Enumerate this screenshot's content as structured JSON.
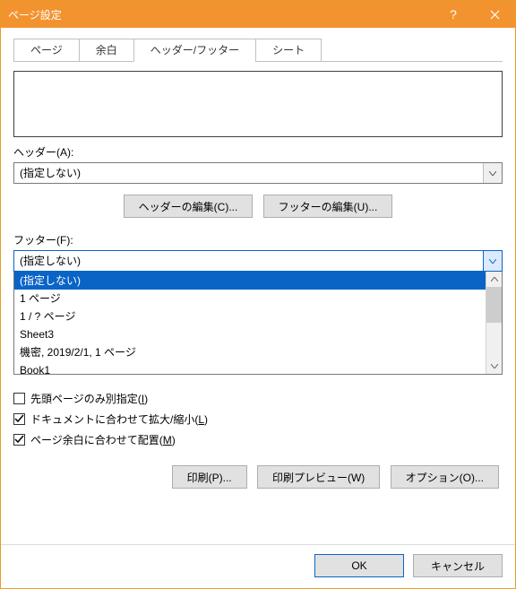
{
  "window": {
    "title": "ページ設定"
  },
  "tabs": {
    "page": "ページ",
    "margins": "余白",
    "headerfooter": "ヘッダー/フッター",
    "sheet": "シート"
  },
  "header": {
    "label": "ヘッダー(A):",
    "value": "(指定しない)",
    "edit_header_btn": "ヘッダーの編集(C)...",
    "edit_footer_btn": "フッターの編集(U)..."
  },
  "footer_sec": {
    "label": "フッター(F):",
    "value": "(指定しない)",
    "options": [
      "(指定しない)",
      "1 ページ",
      "1 / ? ページ",
      "Sheet3",
      " 機密, 2019/2/1, 1 ページ",
      "Book1"
    ],
    "selected_index": 0
  },
  "checks": {
    "diff_first": {
      "label_pre": "先頭ページのみ別指定(",
      "accel": "I",
      "label_post": ")",
      "checked": false
    },
    "scale_doc": {
      "label_pre": "ドキュメントに合わせて拡大/縮小(",
      "accel": "L",
      "label_post": ")",
      "checked": true
    },
    "align_margin": {
      "label_pre": "ページ余白に合わせて配置(",
      "accel": "M",
      "label_post": ")",
      "checked": true
    }
  },
  "action_row": {
    "print": "印刷(P)...",
    "preview": "印刷プレビュー(W)",
    "options": "オプション(O)..."
  },
  "dialog_buttons": {
    "ok": "OK",
    "cancel": "キャンセル"
  }
}
